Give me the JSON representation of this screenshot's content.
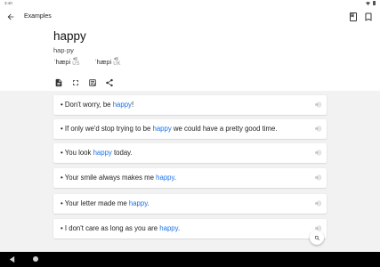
{
  "status_bar": {
    "time": "3:40"
  },
  "app_bar": {
    "title": "Examples",
    "back_icon": "arrow-left-icon",
    "actions": [
      "dictionary-icon",
      "bookmark-icon"
    ]
  },
  "entry": {
    "word": "happy",
    "syllables": "hap·py",
    "pronunciations": [
      {
        "ipa": "ˈhæpi",
        "region": "US"
      },
      {
        "ipa": "ˈhæpi",
        "region": "UK"
      }
    ],
    "tools": [
      "document-icon",
      "fullscreen-icon",
      "flashcard-icon",
      "share-icon"
    ]
  },
  "examples": [
    {
      "before": "Don't worry, be ",
      "highlight": "happy",
      "after": "!"
    },
    {
      "before": "If only we'd stop trying to be ",
      "highlight": "happy",
      "after": " we could have a pretty good time."
    },
    {
      "before": "You look ",
      "highlight": "happy",
      "after": " today."
    },
    {
      "before": "Your smile always makes me ",
      "highlight": "happy",
      "after": "."
    },
    {
      "before": "Your letter made me ",
      "highlight": "happy",
      "after": "."
    },
    {
      "before": "I don't care as long as you are ",
      "highlight": "happy",
      "after": "."
    }
  ],
  "colors": {
    "highlight": "#1a73e8",
    "list_background": "#f2f2f2"
  }
}
